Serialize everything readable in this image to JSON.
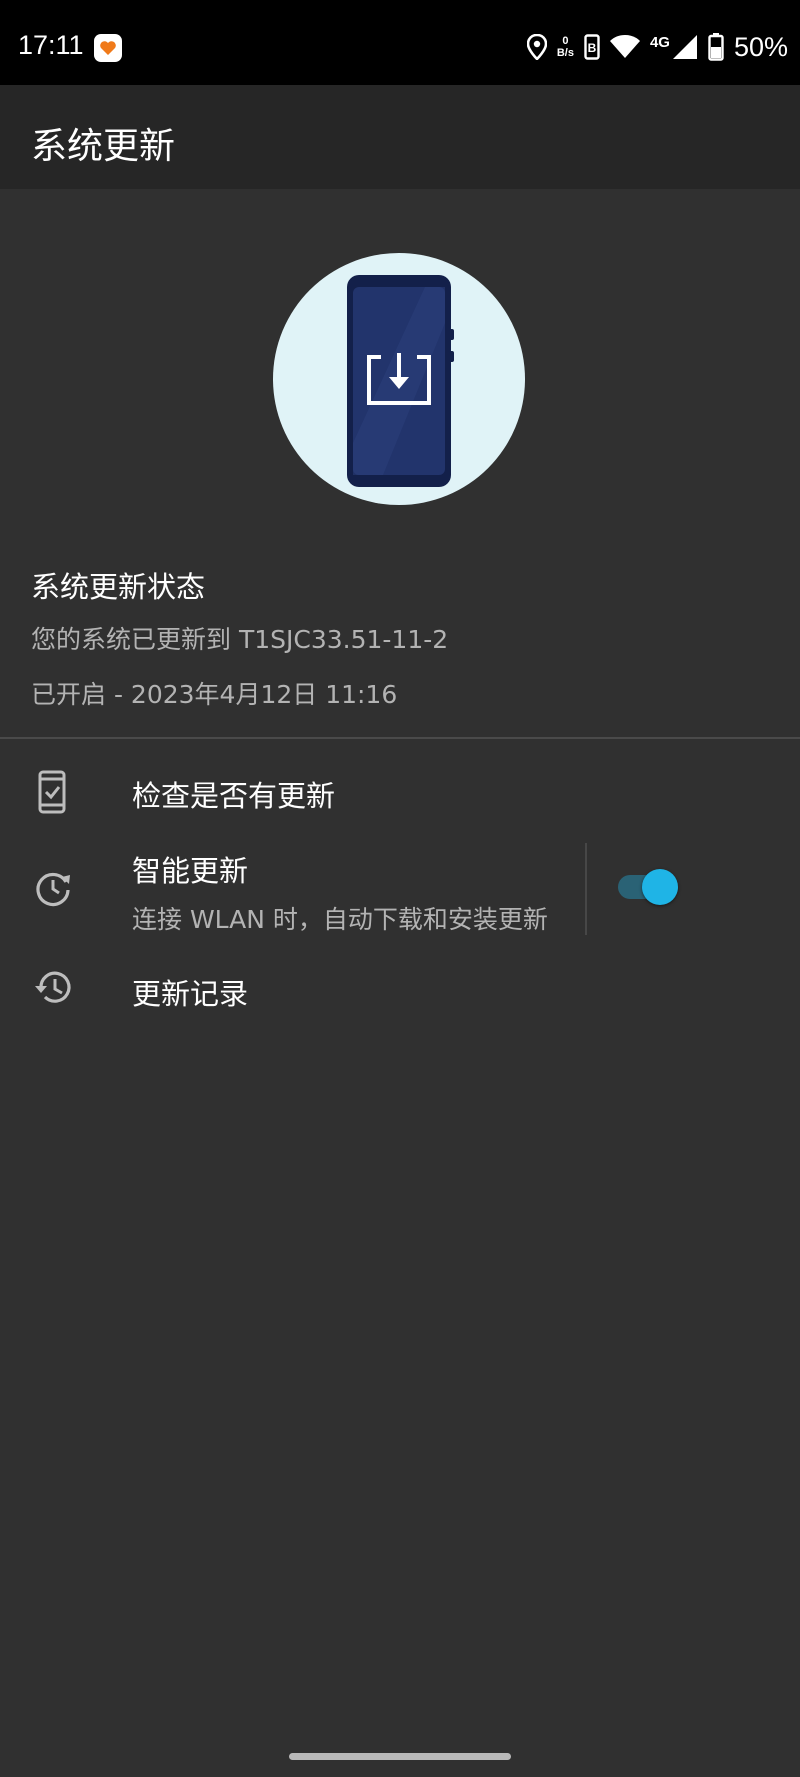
{
  "status_bar": {
    "time": "17:11",
    "net_speed_value": "0",
    "net_speed_unit": "B/s",
    "network_type": "4G",
    "battery": "50%"
  },
  "toolbar": {
    "title": "系统更新"
  },
  "update_status": {
    "title": "系统更新状态",
    "version_text": "您的系统已更新到 T1SJC33.51-11-2",
    "enabled_text": "已开启 - 2023年4月12日 11:16"
  },
  "menu": {
    "check_updates": {
      "label": "检查是否有更新",
      "icon": "phone-check-icon"
    },
    "smart_update": {
      "label": "智能更新",
      "subtitle": "连接 WLAN 时，自动下载和安装更新",
      "icon": "schedule-update-icon",
      "enabled": true
    },
    "update_history": {
      "label": "更新记录",
      "icon": "history-icon"
    }
  },
  "colors": {
    "background": "#303030",
    "toolbar": "#262626",
    "accent": "#1fb4e6",
    "hero_circle": "#e0f3f7",
    "phone_body": "#1b2d5c"
  }
}
